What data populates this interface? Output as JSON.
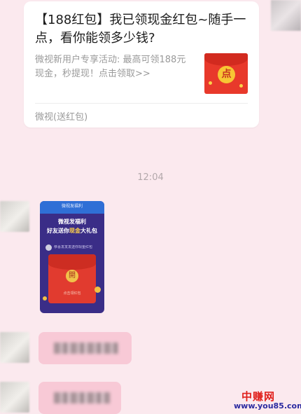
{
  "link_card": {
    "title": "【188红包】我已领现金红包~随手一点，看你能领多少钱?",
    "description": "微视新用户专享活动: 最高可领188元现金，秒提现！点击领取>>",
    "thumbnail_char": "点",
    "source": "微视(送红包)"
  },
  "chat": {
    "timestamp": "12:04",
    "image_message": {
      "header": "微视发福利",
      "headline_1": "微视发福利",
      "headline_2a": "好友送你",
      "headline_2b": "现金",
      "headline_2c": "大礼包",
      "invite_line": "恭喜发发发送你现金红包",
      "open_char": "開",
      "envelope_caption": "点击领红包"
    }
  },
  "watermark": {
    "logo": "中赚网",
    "url": "www.you85.com"
  },
  "colors": {
    "background": "#fbe9ee",
    "bubble_pink": "#f8c9d6",
    "red_packet": "#e8392b",
    "timestamp": "#b3a8ab"
  }
}
